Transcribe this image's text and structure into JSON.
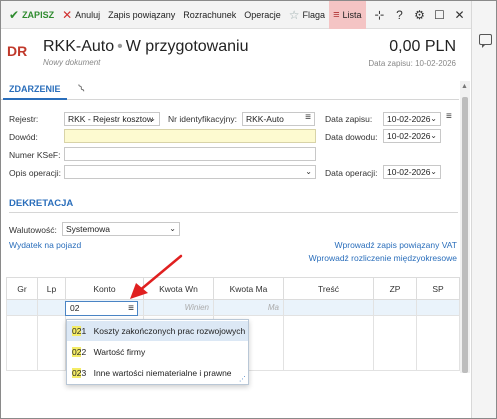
{
  "toolbar": {
    "save": "ZAPISZ",
    "cancel": "Anuluj",
    "linked": "Zapis powiązany",
    "settlement": "Rozrachunek",
    "operations": "Operacje",
    "flag": "Flaga",
    "list": "Lista"
  },
  "header": {
    "badge": "DR",
    "title": "RKK-Auto",
    "status": "W przygotowaniu",
    "subtitle": "Nowy dokument",
    "amount": "0,00 PLN",
    "save_date": "Data zapisu: 10-02-2026"
  },
  "tabs": {
    "event": "ZDARZENIE"
  },
  "form": {
    "register_label": "Rejestr:",
    "register_value": "RKK - Rejestr kosztow",
    "id_label": "Nr identyfikacyjny:",
    "id_value": "RKK-Auto",
    "save_date_label": "Data zapisu:",
    "save_date_value": "10-02-2026",
    "proof_label": "Dowód:",
    "proof_date_label": "Data dowodu:",
    "proof_date_value": "10-02-2026",
    "ksef_label": "Numer KSeF:",
    "op_desc_label": "Opis operacji:",
    "op_date_label": "Data operacji:",
    "op_date_value": "10-02-2026"
  },
  "decree": {
    "section": "DEKRETACJA",
    "currency_label": "Walutowość:",
    "currency_value": "Systemowa",
    "link_vehicle": "Wydatek na pojazd",
    "link_vat": "Wprowadź zapis powiązany VAT",
    "link_accrual": "Wprowadź rozliczenie międzyokresowe"
  },
  "table": {
    "headers": [
      "Gr",
      "Lp",
      "Konto",
      "Kwota Wn",
      "Kwota Ma",
      "Treść",
      "ZP",
      "SP"
    ],
    "konto_input": "02",
    "wn_placeholder": "Winien",
    "ma_placeholder": "Ma"
  },
  "dropdown": {
    "options": [
      {
        "prefix": "02",
        "rest": "1",
        "label": "Koszty zakończonych prac rozwojowych"
      },
      {
        "prefix": "02",
        "rest": "2",
        "label": "Wartość firmy"
      },
      {
        "prefix": "02",
        "rest": "3",
        "label": "Inne wartości niematerialne i prawne"
      }
    ]
  },
  "colors": {
    "accent": "#2a6ebb",
    "brand_red": "#c0392b",
    "save_green": "#2e8b2e",
    "active_tab_bg": "#f4c4c4",
    "required_yellow": "#fdfad0"
  }
}
